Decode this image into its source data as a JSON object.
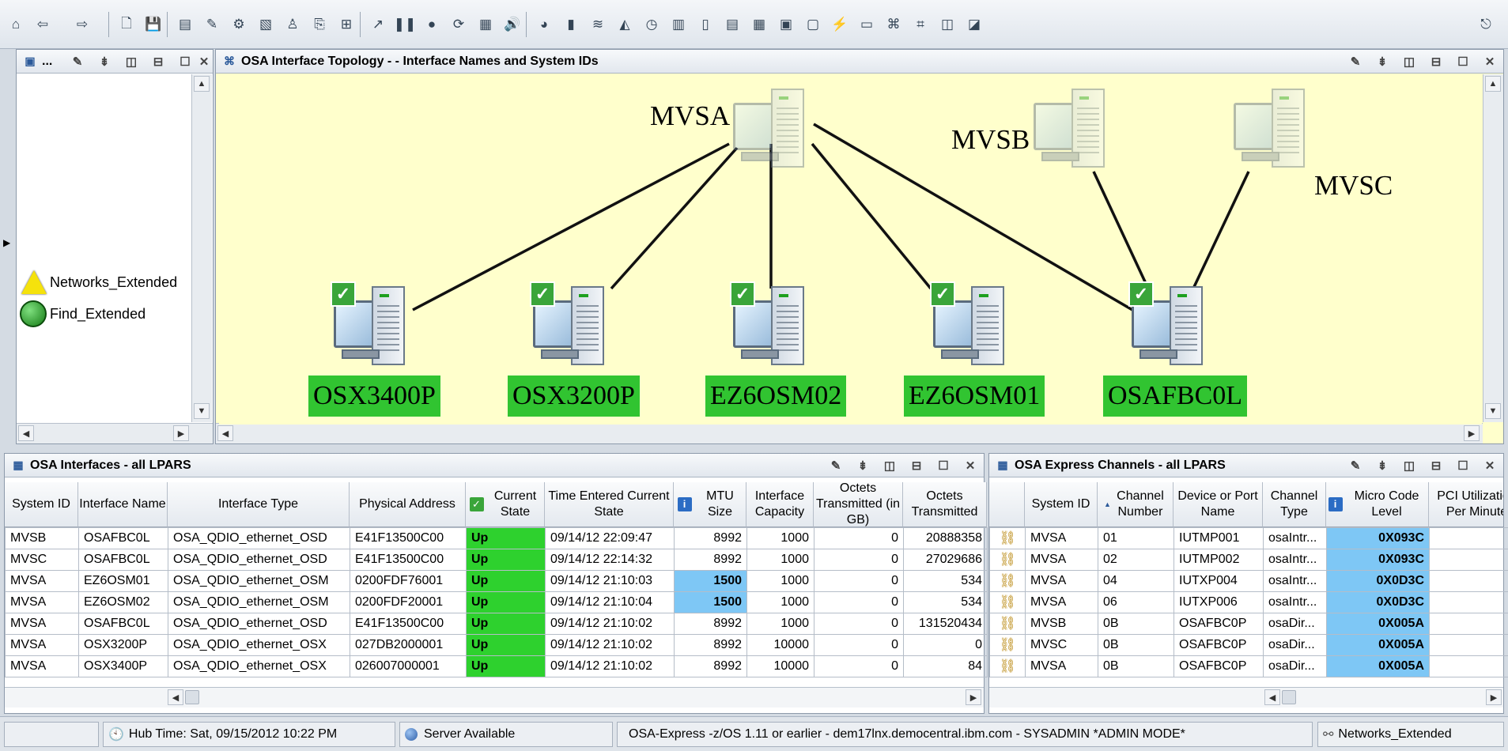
{
  "toolbar": {
    "icons": [
      "home-icon",
      "back-arrow-icon",
      "forward-arrow-icon",
      "new-page-icon",
      "save-icon",
      "workspace-icon",
      "edit-icon",
      "properties-icon",
      "image-icon",
      "person-icon",
      "attach-icon",
      "links-icon",
      "chart-arrow-icon",
      "pause-icon",
      "record-icon",
      "refresh-icon",
      "table-icon",
      "sound-icon",
      "pie-chart-icon",
      "bar-chart-icon",
      "plot-chart-icon",
      "area-chart-icon",
      "gauge-icon",
      "bar-gauge-icon",
      "notepad-icon",
      "event-console-icon",
      "message-log-icon",
      "graphic-view-icon",
      "terminal-icon",
      "lightning-icon",
      "browser-icon",
      "topology-icon",
      "pipe-icon",
      "split-icon",
      "multi-icon",
      "logout-icon"
    ]
  },
  "nav_panel": {
    "title": "...",
    "items": [
      {
        "label": "Networks_Extended",
        "icon": "networks-triangle-icon"
      },
      {
        "label": "Find_Extended",
        "icon": "find-globe-icon"
      }
    ]
  },
  "topology": {
    "title": "OSA Interface Topology - - Interface Names and System IDs",
    "systems": [
      "MVSA",
      "MVSB",
      "MVSC"
    ],
    "interfaces": [
      "OSX3400P",
      "OSX3200P",
      "EZ6OSM02",
      "EZ6OSM01",
      "OSAFBC0L"
    ]
  },
  "osa_interfaces": {
    "title": "OSA Interfaces - all LPARS",
    "columns": [
      "System ID",
      "Interface Name",
      "Interface Type",
      "Physical Address",
      "Current State",
      "Time Entered Current State",
      "MTU Size",
      "Interface Capacity",
      "Octets Transmitted (in GB)",
      "Octets Transmitted"
    ],
    "rows": [
      [
        "MVSB",
        "OSAFBC0L",
        "OSA_QDIO_ethernet_OSD",
        "E41F13500C00",
        "Up",
        "09/14/12 22:09:47",
        "8992",
        "1000",
        "0",
        "20888358"
      ],
      [
        "MVSC",
        "OSAFBC0L",
        "OSA_QDIO_ethernet_OSD",
        "E41F13500C00",
        "Up",
        "09/14/12 22:14:32",
        "8992",
        "1000",
        "0",
        "27029686"
      ],
      [
        "MVSA",
        "EZ6OSM01",
        "OSA_QDIO_ethernet_OSM",
        "0200FDF76001",
        "Up",
        "09/14/12 21:10:03",
        "1500",
        "1000",
        "0",
        "534"
      ],
      [
        "MVSA",
        "EZ6OSM02",
        "OSA_QDIO_ethernet_OSM",
        "0200FDF20001",
        "Up",
        "09/14/12 21:10:04",
        "1500",
        "1000",
        "0",
        "534"
      ],
      [
        "MVSA",
        "OSAFBC0L",
        "OSA_QDIO_ethernet_OSD",
        "E41F13500C00",
        "Up",
        "09/14/12 21:10:02",
        "8992",
        "1000",
        "0",
        "131520434"
      ],
      [
        "MVSA",
        "OSX3200P",
        "OSA_QDIO_ethernet_OSX",
        "027DB2000001",
        "Up",
        "09/14/12 21:10:02",
        "8992",
        "10000",
        "0",
        "0"
      ],
      [
        "MVSA",
        "OSX3400P",
        "OSA_QDIO_ethernet_OSX",
        "026007000001",
        "Up",
        "09/14/12 21:10:02",
        "8992",
        "10000",
        "0",
        "84"
      ]
    ]
  },
  "osa_channels": {
    "title": "OSA Express Channels - all LPARS",
    "columns": [
      "",
      "System ID",
      "Channel Number",
      "Device or Port Name",
      "Channel Type",
      "Micro Code Level",
      "PCI Utilization Per Minute"
    ],
    "rows": [
      [
        "MVSA",
        "01",
        "IUTMP001",
        "osaIntr...",
        "0X093C"
      ],
      [
        "MVSA",
        "02",
        "IUTMP002",
        "osaIntr...",
        "0X093C"
      ],
      [
        "MVSA",
        "04",
        "IUTXP004",
        "osaIntr...",
        "0X0D3C"
      ],
      [
        "MVSA",
        "06",
        "IUTXP006",
        "osaIntr...",
        "0X0D3C"
      ],
      [
        "MVSB",
        "0B",
        "OSAFBC0P",
        "osaDir...",
        "0X005A"
      ],
      [
        "MVSC",
        "0B",
        "OSAFBC0P",
        "osaDir...",
        "0X005A"
      ],
      [
        "MVSA",
        "0B",
        "OSAFBC0P",
        "osaDir...",
        "0X005A"
      ]
    ]
  },
  "status": {
    "hub_time": "Hub Time: Sat, 09/15/2012 10:22 PM",
    "server": "Server Available",
    "info": "OSA-Express -z/OS 1.11 or earlier - dem17lnx.democentral.ibm.com - SYSADMIN   *ADMIN MODE*",
    "workspace": "Networks_Extended"
  },
  "colors": {
    "up": "#2ed12e",
    "highlight": "#7ec7f5",
    "topology_bg": "#ffffcc",
    "node_label": "#31c431"
  }
}
